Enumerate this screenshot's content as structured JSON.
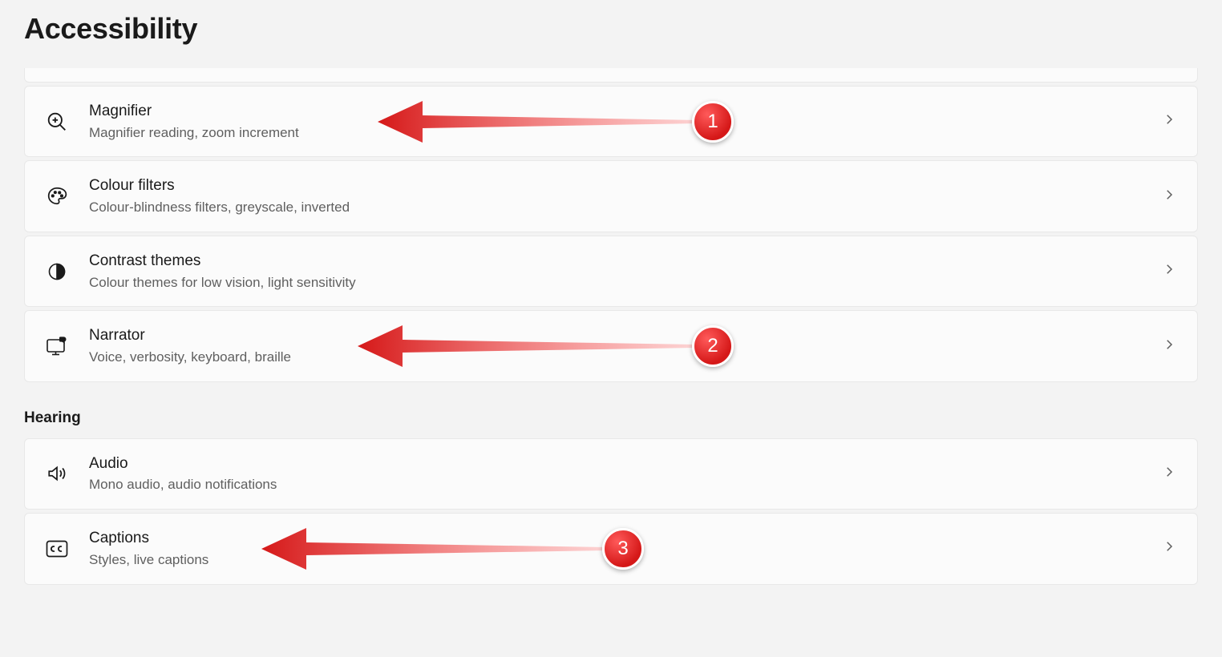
{
  "pageTitle": "Accessibility",
  "sectionHearing": "Hearing",
  "items": [
    {
      "title": "Magnifier",
      "subtitle": "Magnifier reading, zoom increment"
    },
    {
      "title": "Colour filters",
      "subtitle": "Colour-blindness filters, greyscale, inverted"
    },
    {
      "title": "Contrast themes",
      "subtitle": "Colour themes for low vision, light sensitivity"
    },
    {
      "title": "Narrator",
      "subtitle": "Voice, verbosity, keyboard, braille"
    },
    {
      "title": "Audio",
      "subtitle": "Mono audio, audio notifications"
    },
    {
      "title": "Captions",
      "subtitle": "Styles, live captions"
    }
  ],
  "annotations": [
    {
      "label": "1"
    },
    {
      "label": "2"
    },
    {
      "label": "3"
    }
  ]
}
